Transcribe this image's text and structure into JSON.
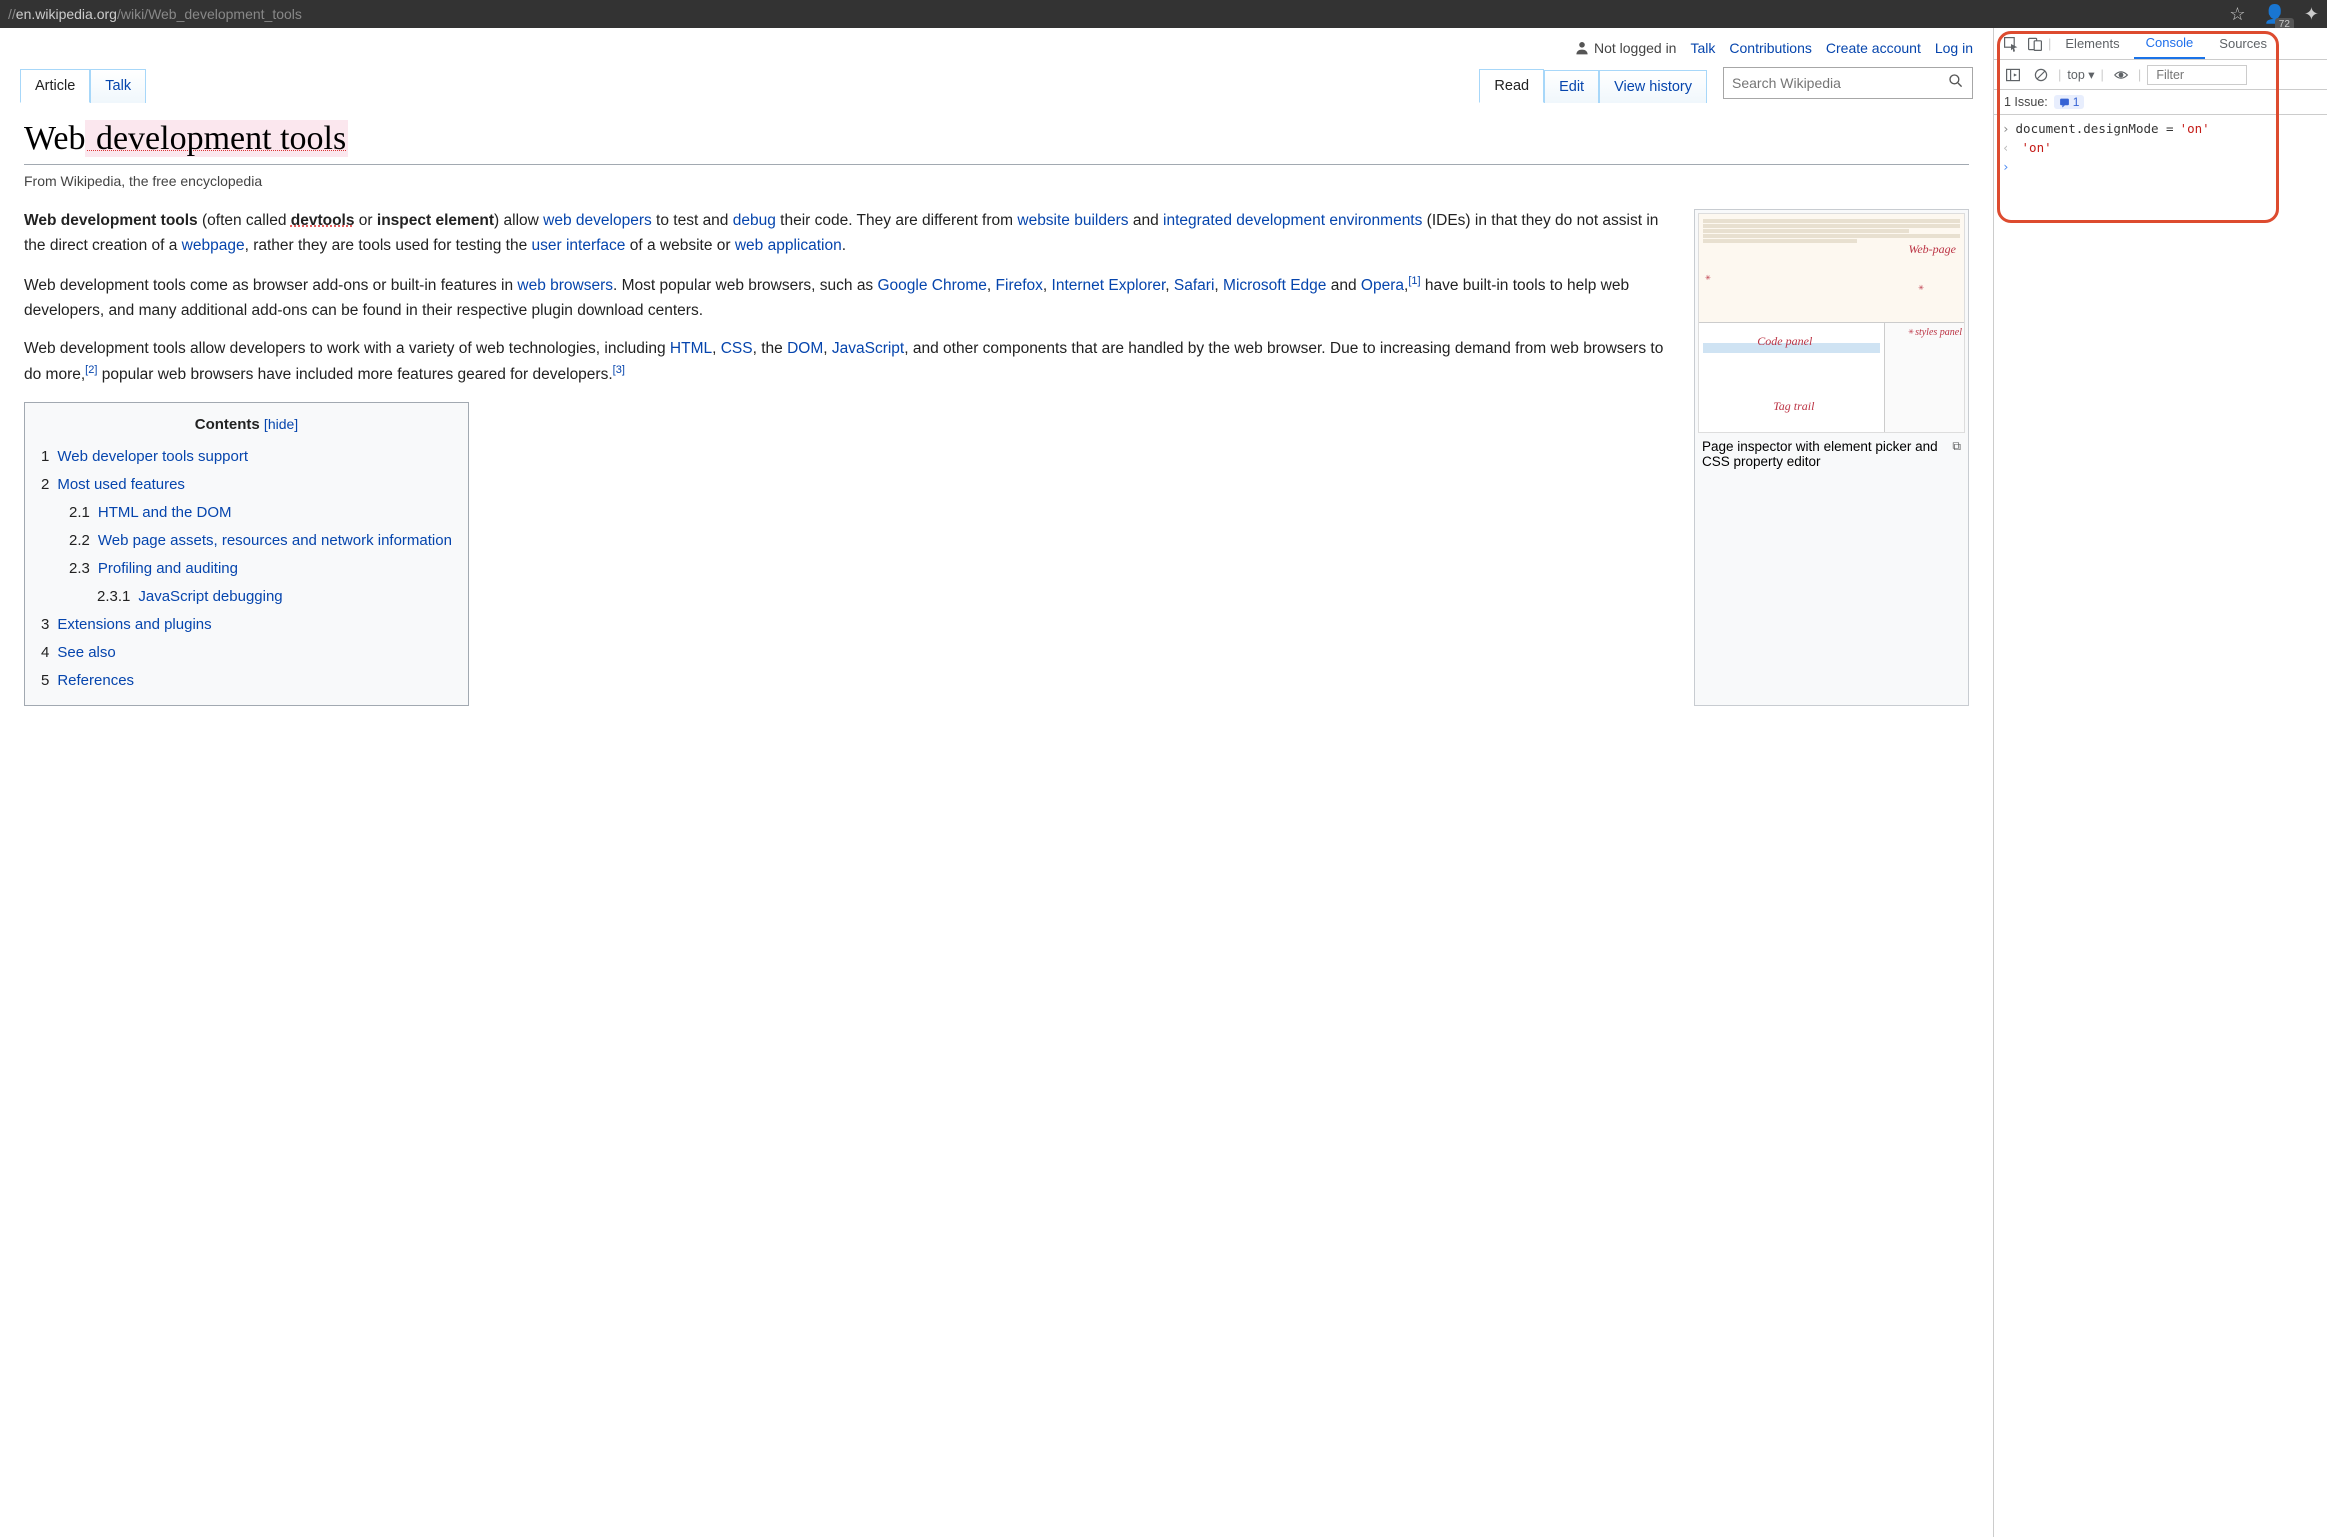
{
  "browser": {
    "url_prefix": "//",
    "url_host": "en.wikipedia.org",
    "url_path": "/wiki/Web_development_tools",
    "badge": "72"
  },
  "wiki": {
    "topbar": {
      "not_logged_in": "Not logged in",
      "talk": "Talk",
      "contributions": "Contributions",
      "create_account": "Create account",
      "log_in": "Log in"
    },
    "tabs_left": {
      "article": "Article",
      "talk": "Talk"
    },
    "tabs_right": {
      "read": "Read",
      "edit": "Edit",
      "view_history": "View history"
    },
    "search_placeholder": "Search Wikipedia",
    "title_plain": "Web",
    "title_hl": " development tools",
    "subtitle": "From Wikipedia, the free encyclopedia",
    "para1": {
      "b1": "Web development tools",
      "t1": " (often called ",
      "b2": "devtools",
      "t2": " or ",
      "b3": "inspect element",
      "t3": ") allow ",
      "l1": "web developers",
      "t4": " to test and ",
      "l2": "debug",
      "t5": " their code. They are different from ",
      "l3": "website builders",
      "t6": " and ",
      "l4": "integrated development environments",
      "t7": " (IDEs) in that they do not assist in the direct creation of a ",
      "l5": "webpage",
      "t8": ", rather they are tools used for testing the ",
      "l6": "user interface",
      "t9": " of a website or ",
      "l7": "web application",
      "t10": "."
    },
    "para2": {
      "t1": "Web development tools come as browser add-ons or built-in features in ",
      "l1": "web browsers",
      "t2": ". Most popular web browsers, such as ",
      "l2": "Google Chrome",
      "t3": ", ",
      "l3": "Firefox",
      "t4": ", ",
      "l4": "Internet Explorer",
      "t5": ", ",
      "l5": "Safari",
      "t6": ", ",
      "l6": "Microsoft Edge",
      "t7": " and ",
      "l7": "Opera",
      "t8": ",",
      "sup1": "[1]",
      "t9": " have built-in tools to help web developers, and many additional add-ons can be found in their respective plugin download centers."
    },
    "para3": {
      "t1": "Web development tools allow developers to work with a variety of web technologies, including ",
      "l1": "HTML",
      "t2": ", ",
      "l2": "CSS",
      "t3": ", the ",
      "l3": "DOM",
      "t4": ", ",
      "l4": "JavaScript",
      "t5": ", and other components that are handled by the web browser. Due to increasing demand from web browsers to do more,",
      "sup1": "[2]",
      "t6": " popular web browsers have included more features geared for developers.",
      "sup2": "[3]"
    },
    "thumb": {
      "caption": "Page inspector with element picker and CSS property editor",
      "label_webpage": "Web-page",
      "label_code": "Code panel",
      "label_styles": "styles panel",
      "label_tag": "Tag trail"
    },
    "toc": {
      "title": "Contents",
      "hide": "hide",
      "items": [
        {
          "n": "1",
          "t": "Web developer tools support",
          "lvl": 0
        },
        {
          "n": "2",
          "t": "Most used features",
          "lvl": 0
        },
        {
          "n": "2.1",
          "t": "HTML and the DOM",
          "lvl": 1
        },
        {
          "n": "2.2",
          "t": "Web page assets, resources and network information",
          "lvl": 1
        },
        {
          "n": "2.3",
          "t": "Profiling and auditing",
          "lvl": 1
        },
        {
          "n": "2.3.1",
          "t": "JavaScript debugging",
          "lvl": 2
        },
        {
          "n": "3",
          "t": "Extensions and plugins",
          "lvl": 0
        },
        {
          "n": "4",
          "t": "See also",
          "lvl": 0
        },
        {
          "n": "5",
          "t": "References",
          "lvl": 0
        }
      ]
    }
  },
  "devtools": {
    "tabs": {
      "elements": "Elements",
      "console": "Console",
      "sources": "Sources"
    },
    "context": "top",
    "filter_placeholder": "Filter",
    "issues_label": "1 Issue:",
    "issues_count": "1",
    "console_lines": [
      {
        "prompt": ">",
        "code": "document.designMode = ",
        "str": "'on'"
      },
      {
        "prompt": "<",
        "code": "",
        "str": "'on'"
      },
      {
        "prompt": ">",
        "code": "",
        "str": ""
      }
    ]
  }
}
